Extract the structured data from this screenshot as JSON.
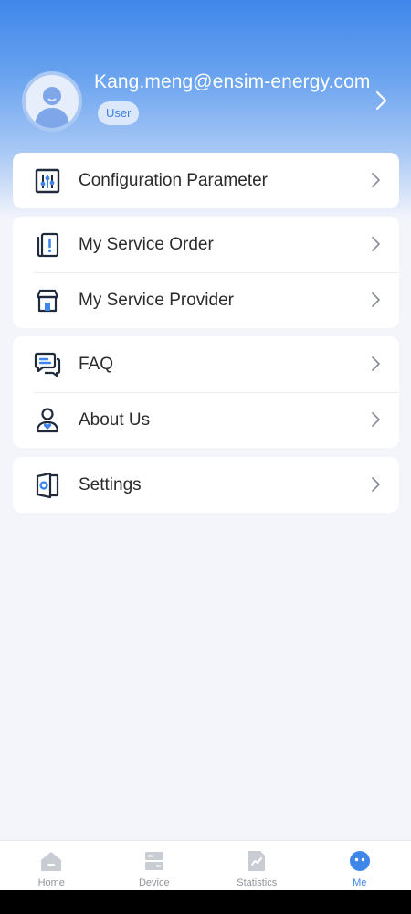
{
  "profile": {
    "email": "Kang.meng@ensim-energy.com",
    "role_badge": "User"
  },
  "menu": {
    "config": {
      "label": "Configuration Parameter",
      "icon": "sliders-icon"
    },
    "service_order": {
      "label": "My Service Order",
      "icon": "order-alert-icon"
    },
    "service_provider": {
      "label": "My Service Provider",
      "icon": "store-icon"
    },
    "faq": {
      "label": "FAQ",
      "icon": "chat-bubbles-icon"
    },
    "about": {
      "label": "About Us",
      "icon": "person-heart-icon"
    },
    "settings": {
      "label": "Settings",
      "icon": "door-settings-icon"
    }
  },
  "tabbar": {
    "home": "Home",
    "device": "Device",
    "statistics": "Statistics",
    "me": "Me",
    "active": "Me"
  },
  "colors": {
    "accent": "#3f86ea",
    "header_top": "#3f87ea",
    "background": "#f3f5fb",
    "inactive": "#8f949c"
  }
}
